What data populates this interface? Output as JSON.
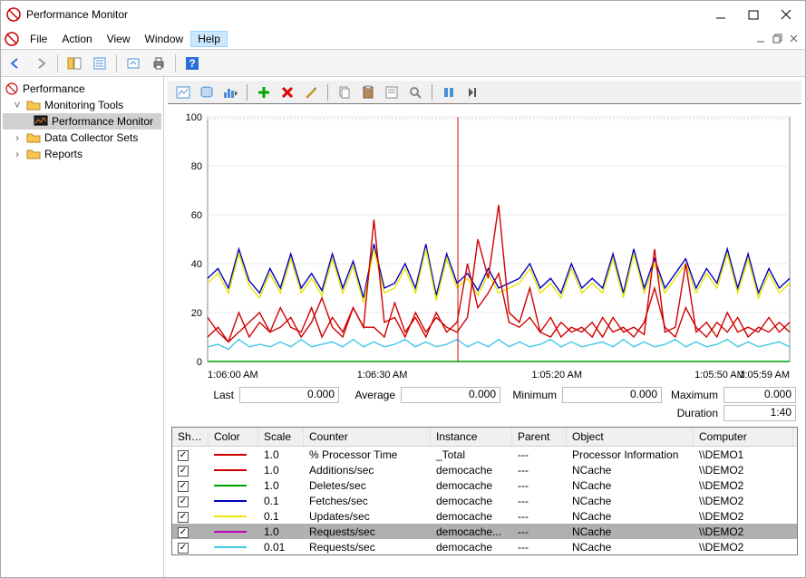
{
  "window": {
    "title": "Performance Monitor"
  },
  "menus": {
    "file": "File",
    "action": "Action",
    "view": "View",
    "window": "Window",
    "help": "Help"
  },
  "tree": {
    "root": "Performance",
    "monTools": "Monitoring Tools",
    "perfMon": "Performance Monitor",
    "dataCollector": "Data Collector Sets",
    "reports": "Reports"
  },
  "chart": {
    "yticks": [
      "100",
      "80",
      "60",
      "40",
      "20",
      "0"
    ],
    "xticks": [
      "1:06:00 AM",
      "1:06:30 AM",
      "1:05:20 AM",
      "1:05:50 AM",
      "1:05:59 AM"
    ]
  },
  "stats": {
    "last_label": "Last",
    "last_value": "0.000",
    "avg_label": "Average",
    "avg_value": "0.000",
    "min_label": "Minimum",
    "min_value": "0.000",
    "max_label": "Maximum",
    "max_value": "0.000",
    "dur_label": "Duration",
    "dur_value": "1:40"
  },
  "table": {
    "headers": {
      "show": "Show",
      "color": "Color",
      "scale": "Scale",
      "counter": "Counter",
      "instance": "Instance",
      "parent": "Parent",
      "object": "Object",
      "computer": "Computer"
    },
    "rows": [
      {
        "color": "#d00000",
        "scale": "1.0",
        "counter": "% Processor Time",
        "instance": "_Total",
        "parent": "---",
        "object": "Processor Information",
        "computer": "\\\\DEMO1"
      },
      {
        "color": "#d00000",
        "scale": "1.0",
        "counter": "Additions/sec",
        "instance": "democache",
        "parent": "---",
        "object": "NCache",
        "computer": "\\\\DEMO2"
      },
      {
        "color": "#00a000",
        "scale": "1.0",
        "counter": "Deletes/sec",
        "instance": "democache",
        "parent": "---",
        "object": "NCache",
        "computer": "\\\\DEMO2"
      },
      {
        "color": "#0000c0",
        "scale": "0.1",
        "counter": "Fetches/sec",
        "instance": "democache",
        "parent": "---",
        "object": "NCache",
        "computer": "\\\\DEMO2"
      },
      {
        "color": "#e6e600",
        "scale": "0.1",
        "counter": "Updates/sec",
        "instance": "democache",
        "parent": "---",
        "object": "NCache",
        "computer": "\\\\DEMO2"
      },
      {
        "color": "#c000c0",
        "scale": "1.0",
        "counter": "Requests/sec",
        "instance": "democache...",
        "parent": "---",
        "object": "NCache",
        "computer": "\\\\DEMO2",
        "selected": true
      },
      {
        "color": "#40c8e8",
        "scale": "0.01",
        "counter": "Requests/sec",
        "instance": "democache",
        "parent": "---",
        "object": "NCache",
        "computer": "\\\\DEMO2"
      }
    ]
  },
  "chart_data": {
    "type": "line",
    "ylim": [
      0,
      100
    ],
    "x_range": [
      "1:06:00 AM",
      "1:05:59 AM"
    ],
    "cursor_x_fraction": 0.43,
    "series": [
      {
        "name": "Fetches/sec",
        "color": "#0000c0",
        "values": [
          34,
          38,
          30,
          46,
          33,
          28,
          38,
          30,
          44,
          30,
          36,
          29,
          44,
          30,
          41,
          26,
          48,
          30,
          32,
          40,
          30,
          48,
          27,
          44,
          32,
          36,
          29,
          38,
          30,
          32,
          34,
          40,
          30,
          34,
          28,
          40,
          30,
          34,
          30,
          44,
          28,
          46,
          30,
          42,
          30,
          36,
          42,
          30,
          38,
          32,
          46,
          30,
          44,
          28,
          38,
          30,
          34
        ]
      },
      {
        "name": "Updates/sec",
        "color": "#e6e600",
        "values": [
          32,
          36,
          28,
          44,
          31,
          26,
          36,
          28,
          42,
          28,
          34,
          27,
          42,
          28,
          39,
          24,
          46,
          28,
          30,
          38,
          28,
          46,
          25,
          42,
          30,
          34,
          27,
          36,
          28,
          30,
          32,
          38,
          28,
          32,
          26,
          38,
          28,
          32,
          28,
          42,
          26,
          44,
          28,
          40,
          28,
          34,
          40,
          28,
          36,
          30,
          44,
          28,
          42,
          26,
          36,
          28,
          32
        ]
      },
      {
        "name": "% Processor Time",
        "color": "#d00000",
        "values": [
          18,
          12,
          8,
          20,
          10,
          16,
          12,
          22,
          14,
          12,
          22,
          10,
          18,
          12,
          22,
          14,
          58,
          16,
          18,
          10,
          20,
          12,
          18,
          14,
          12,
          18,
          50,
          34,
          64,
          20,
          16,
          30,
          12,
          18,
          10,
          14,
          12,
          16,
          10,
          18,
          12,
          14,
          11,
          46,
          12,
          14,
          40,
          12,
          16,
          10,
          20,
          12,
          14,
          12,
          18,
          12,
          16
        ]
      },
      {
        "name": "Additions/sec",
        "color": "#d00000",
        "values": [
          10,
          14,
          8,
          12,
          16,
          20,
          12,
          14,
          18,
          10,
          16,
          26,
          14,
          10,
          22,
          14,
          14,
          10,
          24,
          12,
          18,
          10,
          20,
          12,
          16,
          40,
          22,
          28,
          36,
          16,
          14,
          18,
          12,
          10,
          16,
          12,
          14,
          10,
          18,
          12,
          14,
          10,
          16,
          30,
          14,
          10,
          22,
          14,
          10,
          16,
          12,
          18,
          10,
          14,
          12,
          16,
          12
        ]
      },
      {
        "name": "Requests/sec(cyan)",
        "color": "#40c8e8",
        "values": [
          6,
          7,
          5,
          9,
          6,
          7,
          6,
          8,
          6,
          9,
          6,
          7,
          8,
          6,
          9,
          6,
          8,
          6,
          7,
          9,
          6,
          8,
          6,
          7,
          9,
          6,
          8,
          6,
          9,
          6,
          8,
          6,
          7,
          9,
          6,
          8,
          6,
          7,
          8,
          6,
          9,
          6,
          8,
          6,
          7,
          9,
          6,
          8,
          6,
          7,
          9,
          6,
          8,
          6,
          7,
          8,
          6
        ]
      },
      {
        "name": "Deletes/sec",
        "color": "#00a000",
        "values": [
          0,
          0,
          0,
          0,
          0,
          0,
          0,
          0,
          0,
          0,
          0,
          0,
          0,
          0,
          0,
          0,
          0,
          0,
          0,
          0,
          0,
          0,
          0,
          0,
          0,
          0,
          0,
          0,
          0,
          0,
          0,
          0,
          0,
          0,
          0,
          0,
          0,
          0,
          0,
          0,
          0,
          0,
          0,
          0,
          0,
          0,
          0,
          0,
          0,
          0,
          0,
          0,
          0,
          0,
          0,
          0,
          0
        ]
      }
    ]
  }
}
